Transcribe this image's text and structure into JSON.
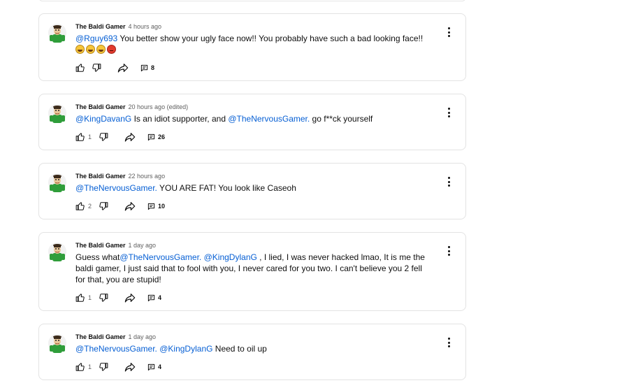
{
  "comments": [
    {
      "author": "The Baldi Gamer",
      "time": "4 hours ago",
      "segments": [
        {
          "type": "mention",
          "text": "@Rguy693"
        },
        {
          "type": "text",
          "text": " You better show your ugly face now!! You probably have such a bad looking face!! "
        }
      ],
      "emojis": [
        "face-with-tears-of-joy",
        "grinning-sweat-face",
        "face-with-tears-of-joy",
        "angry-face"
      ],
      "likes": "",
      "replies": "8"
    },
    {
      "author": "The Baldi Gamer",
      "time": "20 hours ago (edited)",
      "segments": [
        {
          "type": "mention",
          "text": "@KingDavanG"
        },
        {
          "type": "text",
          "text": " Is an idiot supporter, and "
        },
        {
          "type": "mention",
          "text": "@TheNervousGamer."
        },
        {
          "type": "text",
          "text": " go f**ck yourself"
        }
      ],
      "likes": "1",
      "replies": "26"
    },
    {
      "author": "The Baldi Gamer",
      "time": "22 hours ago",
      "segments": [
        {
          "type": "mention",
          "text": "@TheNervousGamer."
        },
        {
          "type": "text",
          "text": " YOU ARE FAT! You look like Caseoh"
        }
      ],
      "likes": "2",
      "replies": "10"
    },
    {
      "author": "The Baldi Gamer",
      "time": "1 day ago",
      "segments": [
        {
          "type": "text",
          "text": "Guess what"
        },
        {
          "type": "mention",
          "text": "@TheNervousGamer."
        },
        {
          "type": "text",
          "text": " "
        },
        {
          "type": "mention",
          "text": "@KingDylanG"
        },
        {
          "type": "text",
          "text": " , I lied, I was never hacked lmao, It is me the baldi gamer, I just said that to fool with you, I never cared for you two. I can't believe you 2 fell for that, you are stupid!"
        }
      ],
      "likes": "1",
      "replies": "4"
    },
    {
      "author": "The Baldi Gamer",
      "time": "1 day ago",
      "segments": [
        {
          "type": "mention",
          "text": "@TheNervousGamer."
        },
        {
          "type": "text",
          "text": " "
        },
        {
          "type": "mention",
          "text": "@KingDylanG"
        },
        {
          "type": "text",
          "text": " Need to oil up"
        }
      ],
      "likes": "1",
      "replies": "4"
    }
  ],
  "icons": {
    "like": "thumbs-up-icon",
    "dislike": "thumbs-down-icon",
    "share": "share-icon",
    "replies": "comment-icon",
    "menu": "more-vert-icon",
    "avatar": "baldi-avatar"
  },
  "colors": {
    "mention": "#065fd4",
    "meta": "#606060",
    "border": "#e3e3e3"
  }
}
